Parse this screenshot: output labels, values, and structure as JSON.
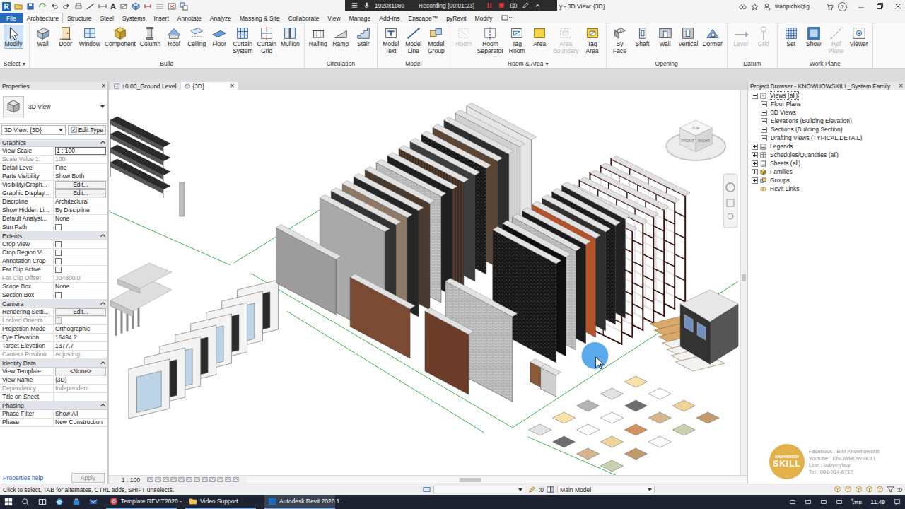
{
  "title_bar": {
    "logo": "R",
    "quick_access_glyph": "A",
    "recorder": {
      "resolution": "1920x1080",
      "label": "Recording [00:01:23]"
    },
    "title": "y - 3D View: {3D}",
    "user": "wanpichk@g...",
    "help": "?"
  },
  "ribbon": {
    "tabs": [
      {
        "label": "File",
        "selected": false,
        "kind": "file"
      },
      {
        "label": "Architecture",
        "selected": true,
        "kind": "tab"
      },
      {
        "label": "Structure",
        "selected": false,
        "kind": "tab"
      },
      {
        "label": "Steel",
        "selected": false,
        "kind": "tab"
      },
      {
        "label": "Systems",
        "selected": false,
        "kind": "tab"
      },
      {
        "label": "Insert",
        "selected": false,
        "kind": "tab"
      },
      {
        "label": "Annotate",
        "selected": false,
        "kind": "tab"
      },
      {
        "label": "Analyze",
        "selected": false,
        "kind": "tab"
      },
      {
        "label": "Massing & Site",
        "selected": false,
        "kind": "tab"
      },
      {
        "label": "Collaborate",
        "selected": false,
        "kind": "tab"
      },
      {
        "label": "View",
        "selected": false,
        "kind": "tab"
      },
      {
        "label": "Manage",
        "selected": false,
        "kind": "tab"
      },
      {
        "label": "Add-Ins",
        "selected": false,
        "kind": "tab"
      },
      {
        "label": "Enscape™",
        "selected": false,
        "kind": "tab"
      },
      {
        "label": "pyRevit",
        "selected": false,
        "kind": "tab"
      },
      {
        "label": "Modify",
        "selected": false,
        "kind": "tab"
      }
    ],
    "panels": [
      {
        "title": "Select",
        "arrow": "▾",
        "buttons": [
          {
            "label": "Modify",
            "selected": true,
            "disabled": false
          }
        ]
      },
      {
        "title": "Build",
        "buttons": [
          {
            "label": "Wall",
            "selected": false,
            "disabled": false
          },
          {
            "label": "Door",
            "selected": false,
            "disabled": false
          },
          {
            "label": "Window",
            "selected": false,
            "disabled": false
          },
          {
            "label": "Component",
            "selected": false,
            "disabled": false
          },
          {
            "label": "Column",
            "selected": false,
            "disabled": false
          },
          {
            "label": "Roof",
            "selected": false,
            "disabled": false
          },
          {
            "label": "Ceiling",
            "selected": false,
            "disabled": false
          },
          {
            "label": "Floor",
            "selected": false,
            "disabled": false
          },
          {
            "label": "Curtain System",
            "selected": false,
            "disabled": false
          },
          {
            "label": "Curtain Grid",
            "selected": false,
            "disabled": false
          },
          {
            "label": "Mullion",
            "selected": false,
            "disabled": false
          }
        ]
      },
      {
        "title": "Circulation",
        "buttons": [
          {
            "label": "Railing",
            "selected": false,
            "disabled": false
          },
          {
            "label": "Ramp",
            "selected": false,
            "disabled": false
          },
          {
            "label": "Stair",
            "selected": false,
            "disabled": false
          }
        ]
      },
      {
        "title": "Model",
        "buttons": [
          {
            "label": "Model Text",
            "selected": false,
            "disabled": false
          },
          {
            "label": "Model Line",
            "selected": false,
            "disabled": false
          },
          {
            "label": "Model Group",
            "selected": false,
            "disabled": false
          }
        ]
      },
      {
        "title": "Room & Area",
        "arrow": "▾",
        "buttons": [
          {
            "label": "Room",
            "selected": false,
            "disabled": true
          },
          {
            "label": "Room Separator",
            "selected": false,
            "disabled": false
          },
          {
            "label": "Tag Room",
            "selected": false,
            "disabled": false
          },
          {
            "label": "Area",
            "selected": false,
            "disabled": false
          },
          {
            "label": "Area Boundary",
            "selected": false,
            "disabled": true
          },
          {
            "label": "Tag Area",
            "selected": false,
            "disabled": false
          }
        ]
      },
      {
        "title": "Opening",
        "buttons": [
          {
            "label": "By Face",
            "selected": false,
            "disabled": false
          },
          {
            "label": "Shaft",
            "selected": false,
            "disabled": false
          },
          {
            "label": "Wall",
            "selected": false,
            "disabled": false
          },
          {
            "label": "Vertical",
            "selected": false,
            "disabled": false
          },
          {
            "label": "Dormer",
            "selected": false,
            "disabled": false
          }
        ]
      },
      {
        "title": "Datum",
        "buttons": [
          {
            "label": "Level",
            "selected": false,
            "disabled": true
          },
          {
            "label": "Grid",
            "selected": false,
            "disabled": true
          }
        ]
      },
      {
        "title": "Work Plane",
        "buttons": [
          {
            "label": "Set",
            "selected": false,
            "disabled": false
          },
          {
            "label": "Show",
            "selected": false,
            "disabled": false
          },
          {
            "label": "Ref Plane",
            "selected": false,
            "disabled": true
          },
          {
            "label": "Viewer",
            "selected": false,
            "disabled": false
          }
        ]
      }
    ]
  },
  "properties": {
    "title": "Properties",
    "close": "×",
    "type_name": "3D View",
    "selector": "3D View: {3D}",
    "edit_type": "Edit Type",
    "groups": [
      {
        "name": "Graphics",
        "expanded": true,
        "rows": [
          {
            "label": "View Scale",
            "value": "1 : 100",
            "kind": "input",
            "disabled": false
          },
          {
            "label": "Scale Value 1:",
            "value": "100",
            "kind": "text",
            "disabled": true
          },
          {
            "label": "Detail Level",
            "value": "Fine",
            "kind": "text",
            "disabled": false
          },
          {
            "label": "Parts Visibility",
            "value": "Show Both",
            "kind": "text",
            "disabled": false
          },
          {
            "label": "Visibility/Graph...",
            "value": "Edit...",
            "kind": "button",
            "disabled": false
          },
          {
            "label": "Graphic Display...",
            "value": "Edit...",
            "kind": "button",
            "disabled": false
          },
          {
            "label": "Discipline",
            "value": "Architectural",
            "kind": "text",
            "disabled": false
          },
          {
            "label": "Show Hidden Li...",
            "value": "By Discipline",
            "kind": "text",
            "disabled": false
          },
          {
            "label": "Default Analysi...",
            "value": "None",
            "kind": "text",
            "disabled": false
          },
          {
            "label": "Sun Path",
            "value": "",
            "kind": "check",
            "checked": false,
            "disabled": false
          }
        ]
      },
      {
        "name": "Extents",
        "expanded": true,
        "rows": [
          {
            "label": "Crop View",
            "value": "",
            "kind": "check",
            "checked": false,
            "disabled": false
          },
          {
            "label": "Crop Region Vi...",
            "value": "",
            "kind": "check",
            "checked": false,
            "disabled": false
          },
          {
            "label": "Annotation Crop",
            "value": "",
            "kind": "check",
            "checked": false,
            "disabled": false
          },
          {
            "label": "Far Clip Active",
            "value": "",
            "kind": "check",
            "checked": false,
            "disabled": false
          },
          {
            "label": "Far Clip Offset",
            "value": "304800.0",
            "kind": "text",
            "disabled": true
          },
          {
            "label": "Scope Box",
            "value": "None",
            "kind": "text",
            "disabled": false
          },
          {
            "label": "Section Box",
            "value": "",
            "kind": "check",
            "checked": false,
            "disabled": false
          }
        ]
      },
      {
        "name": "Camera",
        "expanded": true,
        "rows": [
          {
            "label": "Rendering Setti...",
            "value": "Edit...",
            "kind": "button",
            "disabled": false
          },
          {
            "label": "Locked Orienta...",
            "value": "",
            "kind": "check",
            "checked": false,
            "disabled": true
          },
          {
            "label": "Projection Mode",
            "value": "Orthographic",
            "kind": "text",
            "disabled": false
          },
          {
            "label": "Eye Elevation",
            "value": "16494.2",
            "kind": "text",
            "disabled": false
          },
          {
            "label": "Target Elevation",
            "value": "1377.7",
            "kind": "text",
            "disabled": false
          },
          {
            "label": "Camera Position",
            "value": "Adjusting",
            "kind": "text",
            "disabled": true
          }
        ]
      },
      {
        "name": "Identity Data",
        "expanded": true,
        "rows": [
          {
            "label": "View Template",
            "value": "<None>",
            "kind": "button",
            "disabled": false
          },
          {
            "label": "View Name",
            "value": "{3D}",
            "kind": "text",
            "disabled": false
          },
          {
            "label": "Dependency",
            "value": "Independent",
            "kind": "text",
            "disabled": true
          },
          {
            "label": "Title on Sheet",
            "value": "",
            "kind": "text",
            "disabled": false
          }
        ]
      },
      {
        "name": "Phasing",
        "expanded": true,
        "rows": [
          {
            "label": "Phase Filter",
            "value": "Show All",
            "kind": "text",
            "disabled": false
          },
          {
            "label": "Phase",
            "value": "New Construction",
            "kind": "text",
            "disabled": false
          }
        ]
      }
    ],
    "help": "Properties help",
    "apply": "Apply",
    "apply_disabled": true
  },
  "view_tabs": [
    {
      "label": "+0.00_Ground Level",
      "selected": false,
      "closable": false
    },
    {
      "label": "{3D}",
      "selected": true,
      "closable": true
    }
  ],
  "view_tab_close": "×",
  "canvas": {
    "view_cube": {
      "top": "TOP",
      "front": "FRONT",
      "right": "RIGHT"
    }
  },
  "view_control": {
    "scale": "1 : 100"
  },
  "project_browser": {
    "title": "Project Browser - KNOWHOWSKILL_System Family",
    "close": "×",
    "items": [
      {
        "label": "Views (all)",
        "level": 0,
        "expandable": true,
        "expanded": true,
        "selected": true
      },
      {
        "label": "Floor Plans",
        "level": 1,
        "expandable": true,
        "expanded": false,
        "selected": false
      },
      {
        "label": "3D Views",
        "level": 1,
        "expandable": true,
        "expanded": false,
        "selected": false
      },
      {
        "label": "Elevations (Building Elevation)",
        "level": 1,
        "expandable": true,
        "expanded": false,
        "selected": false
      },
      {
        "label": "Sections (Building Section)",
        "level": 1,
        "expandable": true,
        "expanded": false,
        "selected": false
      },
      {
        "label": "Drafting Views (TYPICAL DETAIL)",
        "level": 1,
        "expandable": true,
        "expanded": false,
        "selected": false
      },
      {
        "label": "Legends",
        "level": 0,
        "expandable": true,
        "expanded": false,
        "selected": false
      },
      {
        "label": "Schedules/Quantities (all)",
        "level": 0,
        "expandable": true,
        "expanded": false,
        "selected": false
      },
      {
        "label": "Sheets (all)",
        "level": 0,
        "expandable": true,
        "expanded": false,
        "selected": false
      },
      {
        "label": "Families",
        "level": 0,
        "expandable": true,
        "expanded": false,
        "selected": false
      },
      {
        "label": "Groups",
        "level": 0,
        "expandable": true,
        "expanded": false,
        "selected": false
      },
      {
        "label": "Revit Links",
        "level": 0,
        "expandable": false,
        "expanded": false,
        "selected": false
      }
    ]
  },
  "watermark": {
    "logo_top": "KNOWHOW",
    "logo_bottom": "SKILL",
    "lines": [
      "Facebook : BIM Knowhowskill",
      "Youtube : KNOWHOWSKILL",
      "Line : babymyboy",
      "Tel : 081-914-6717"
    ]
  },
  "status_bar": {
    "message": "Click to select, TAB for alternates, CTRL adds, SHIFT unselects.",
    "workset_count": ":0",
    "design_option": "Main Model",
    "filter_count": ":0"
  },
  "taskbar": {
    "apps": [
      {
        "label": "Template REVIT2020 - ...",
        "active": false
      },
      {
        "label": "Video Support",
        "active": false
      },
      {
        "label": "Autodesk Revit 2020.1...",
        "active": true
      }
    ],
    "language": "ไทย",
    "time": "11:49"
  }
}
